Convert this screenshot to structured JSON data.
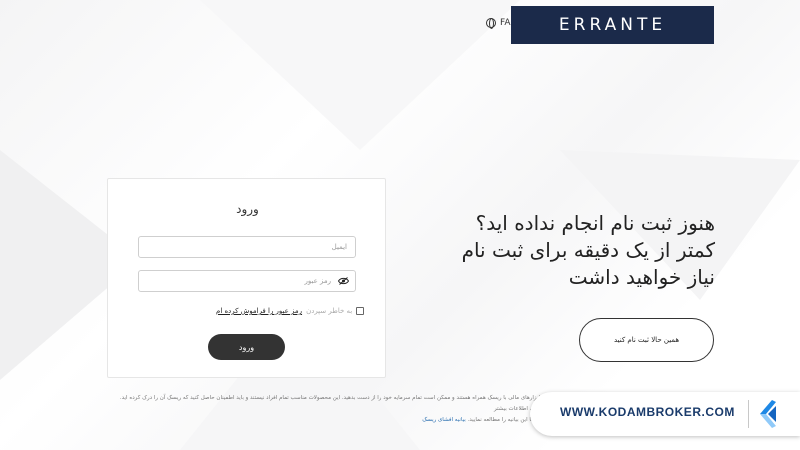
{
  "header": {
    "language": "FA",
    "logo_text": "ERRANTE"
  },
  "login": {
    "title": "ورود",
    "email_placeholder": "ایمیل",
    "password_placeholder": "رمز عبور",
    "remember_label": "به خاطر سپردن",
    "forgot_link": "رمز عبور را فراموش کرده ام",
    "submit_label": "ورود"
  },
  "promo": {
    "headline_lines": [
      "هنوز ثبت نام انجام نداده اید؟",
      "کمتر از یک دقیقه برای ثبت نام",
      "نیاز خواهید داشت"
    ],
    "register_button": "همین حالا ثبت نام کنید"
  },
  "disclaimer": {
    "line1": "ابزارهای مالی با ریسک همراه هستند و ممکن است تمام سرمایه خود را از دست بدهید. این محصولات مناسب تمام افراد نیستند و باید اطمینان حاصل کنید که ریسک آن را درک کرده اید. برای اطلاعات بیشتر",
    "line2_prefix": "لطفا این بیانیه را مطالعه نمایید.",
    "risk_link": "بیانیه افشای ریسک"
  },
  "watermark": {
    "text": "WWW.KODAMBROKER.COM"
  },
  "colors": {
    "logo_bg": "#1b2a4a",
    "logo_accent": "#c8102e",
    "button_dark": "#333333",
    "watermark_text": "#1a3b6b",
    "kodam_blue": "#1e88e5"
  }
}
